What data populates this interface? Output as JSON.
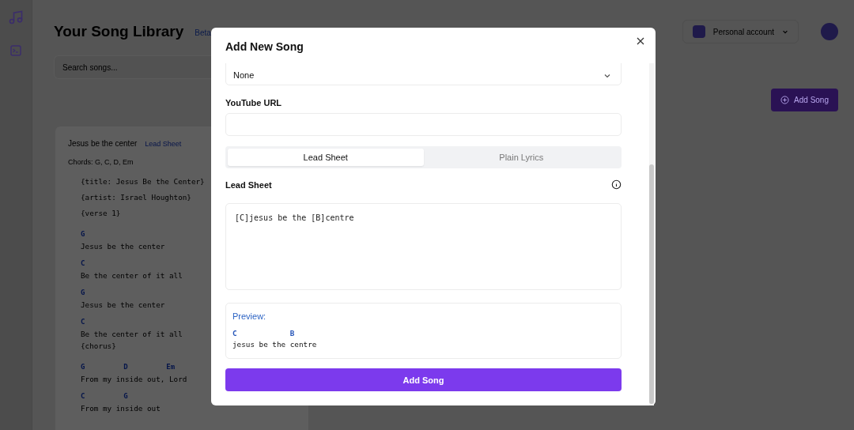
{
  "header": {
    "title": "Your Song Library",
    "badge": "Beta",
    "account": "Personal account"
  },
  "search": {
    "placeholder": "Search songs..."
  },
  "add_button": "Add Song",
  "song_card": {
    "title": "Jesus be the center",
    "tag": "Lead Sheet",
    "chords": "Chords: G, C, D, Em",
    "lines": [
      {
        "kind": "directive",
        "text": "{title: Jesus Be the Center}"
      },
      {
        "kind": "directive",
        "text": "{artist: Israel Houghton}"
      },
      {
        "kind": "directive",
        "text": "{verse 1}"
      },
      {
        "kind": "chords",
        "text": "G"
      },
      {
        "kind": "lyric",
        "text": "Jesus be the center"
      },
      {
        "kind": "chords",
        "text": "C"
      },
      {
        "kind": "lyric",
        "text": "Be the center of it all"
      },
      {
        "kind": "chords",
        "text": "G"
      },
      {
        "kind": "lyric",
        "text": "Jesus be the center"
      },
      {
        "kind": "chords",
        "text": "C"
      },
      {
        "kind": "lyric",
        "text": "Be the center of it all"
      },
      {
        "kind": "directive",
        "text": "{chorus}"
      },
      {
        "kind": "chords",
        "text": "G         D         Em"
      },
      {
        "kind": "lyric",
        "text": "From my inside out, Lord"
      },
      {
        "kind": "chords",
        "text": "C         G"
      },
      {
        "kind": "lyric",
        "text": "From my inside out"
      }
    ]
  },
  "modal": {
    "title": "Add New Song",
    "select": {
      "value": "None"
    },
    "youtube": {
      "label": "YouTube URL"
    },
    "tabs": [
      {
        "label": "Lead Sheet",
        "selected": true
      },
      {
        "label": "Plain Lyrics",
        "selected": false
      }
    ],
    "editor": {
      "label": "Lead Sheet",
      "value": "[C]jesus be the [B]centre"
    },
    "preview": {
      "label": "Preview:",
      "lines": [
        {
          "kind": "chords",
          "text": "C            B"
        },
        {
          "kind": "lyric",
          "text": "jesus be the centre"
        }
      ]
    },
    "submit": "Add Song"
  }
}
